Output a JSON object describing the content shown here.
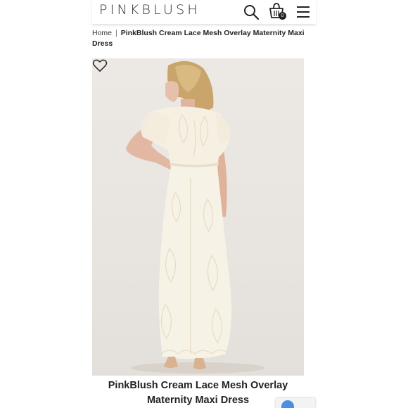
{
  "header": {
    "logo": "PINKBLUSH",
    "cart_count": "0",
    "icons": [
      "search-icon",
      "shopping-bag-icon",
      "hamburger-menu-icon"
    ]
  },
  "breadcrumb": {
    "home": "Home",
    "separator": "|",
    "current": "PinkBlush Cream Lace Mesh Overlay Maternity Maxi Dress"
  },
  "product": {
    "title": "PinkBlush Cream Lace Mesh Overlay Maternity Maxi Dress",
    "wishlist_icon": "heart-icon",
    "image_alt": "Model wearing cream lace mesh maxi dress"
  },
  "colors": {
    "background": "#ffffff",
    "text": "#222222",
    "photo_bg": "#e9e5e0",
    "dress": "#f7f2e6"
  }
}
